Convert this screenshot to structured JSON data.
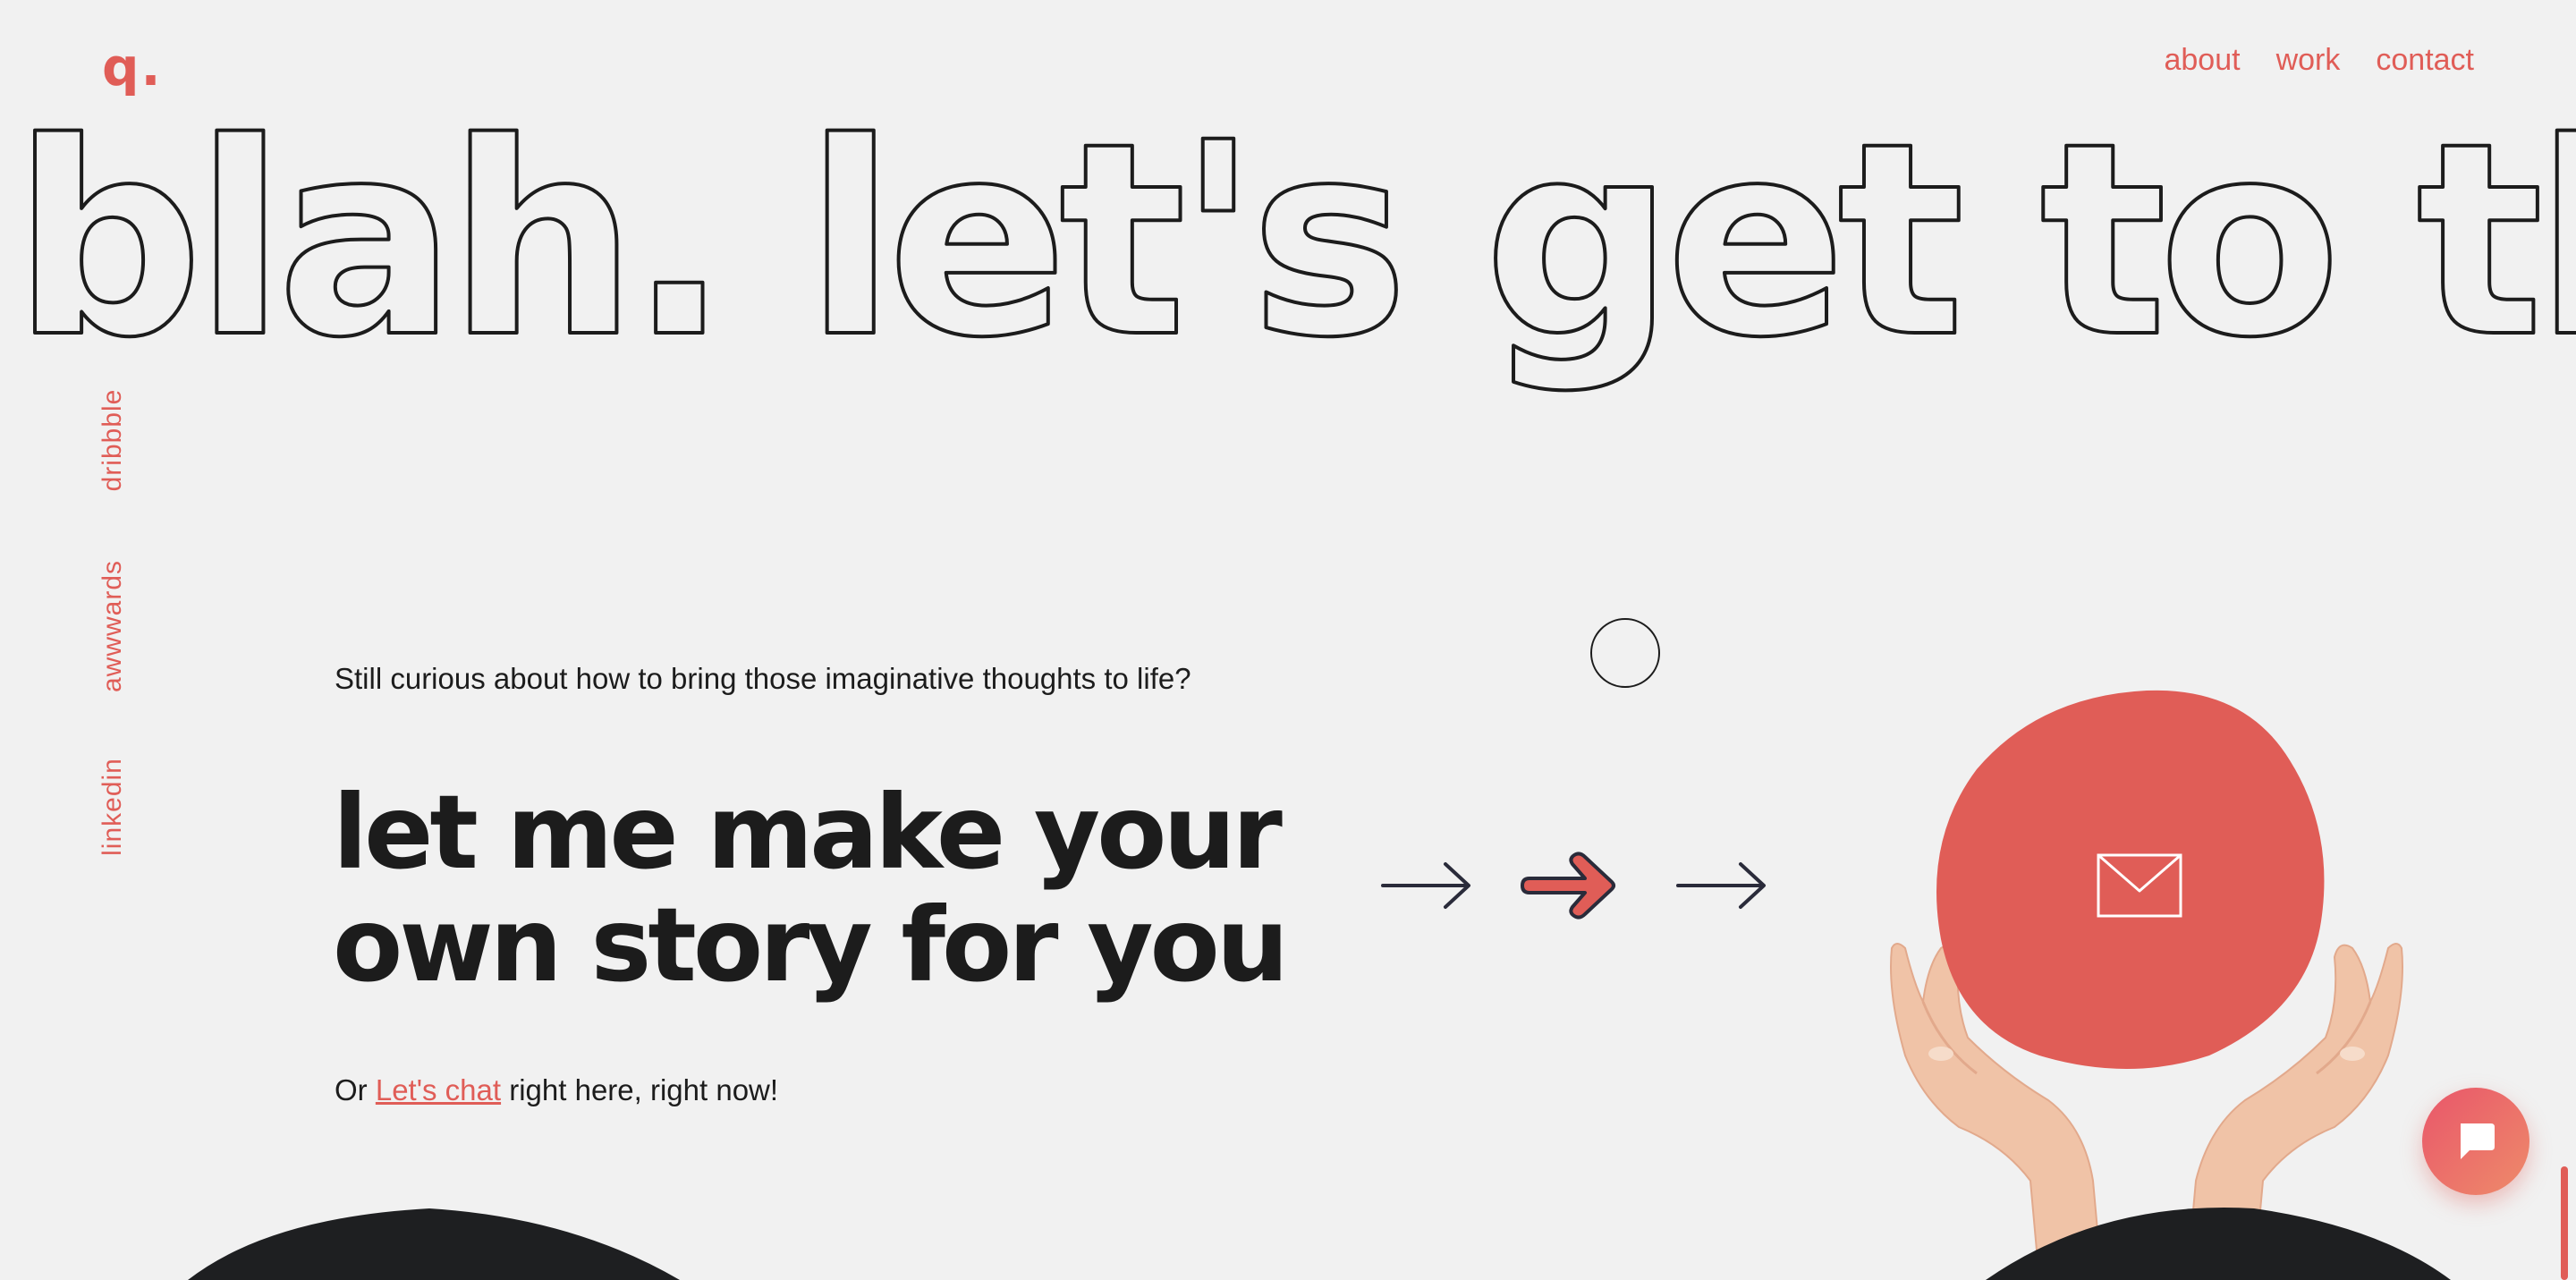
{
  "logo": {
    "text": "q."
  },
  "nav": {
    "items": [
      {
        "label": "about"
      },
      {
        "label": "work"
      },
      {
        "label": "contact"
      }
    ]
  },
  "marquee": {
    "text": "blah. let's get to the po"
  },
  "social": {
    "items": [
      {
        "label": "dribbble"
      },
      {
        "label": "awwwards"
      },
      {
        "label": "linkedin"
      }
    ]
  },
  "main": {
    "intro": "Still curious about how to bring those imaginative thoughts to life?",
    "headline_line1": "let me make your",
    "headline_line2": "own story for you",
    "cta_prefix": "Or",
    "cta_link": "Let's chat",
    "cta_suffix": "right here, right now!"
  },
  "icons": {
    "mail": "mail-icon",
    "chat": "chat-bubble-icon",
    "arrow": "arrow-right-icon"
  },
  "colors": {
    "accent": "#e05d57",
    "text": "#1c1c1c",
    "background": "#f1f1f1",
    "dark": "#1e1f21"
  }
}
